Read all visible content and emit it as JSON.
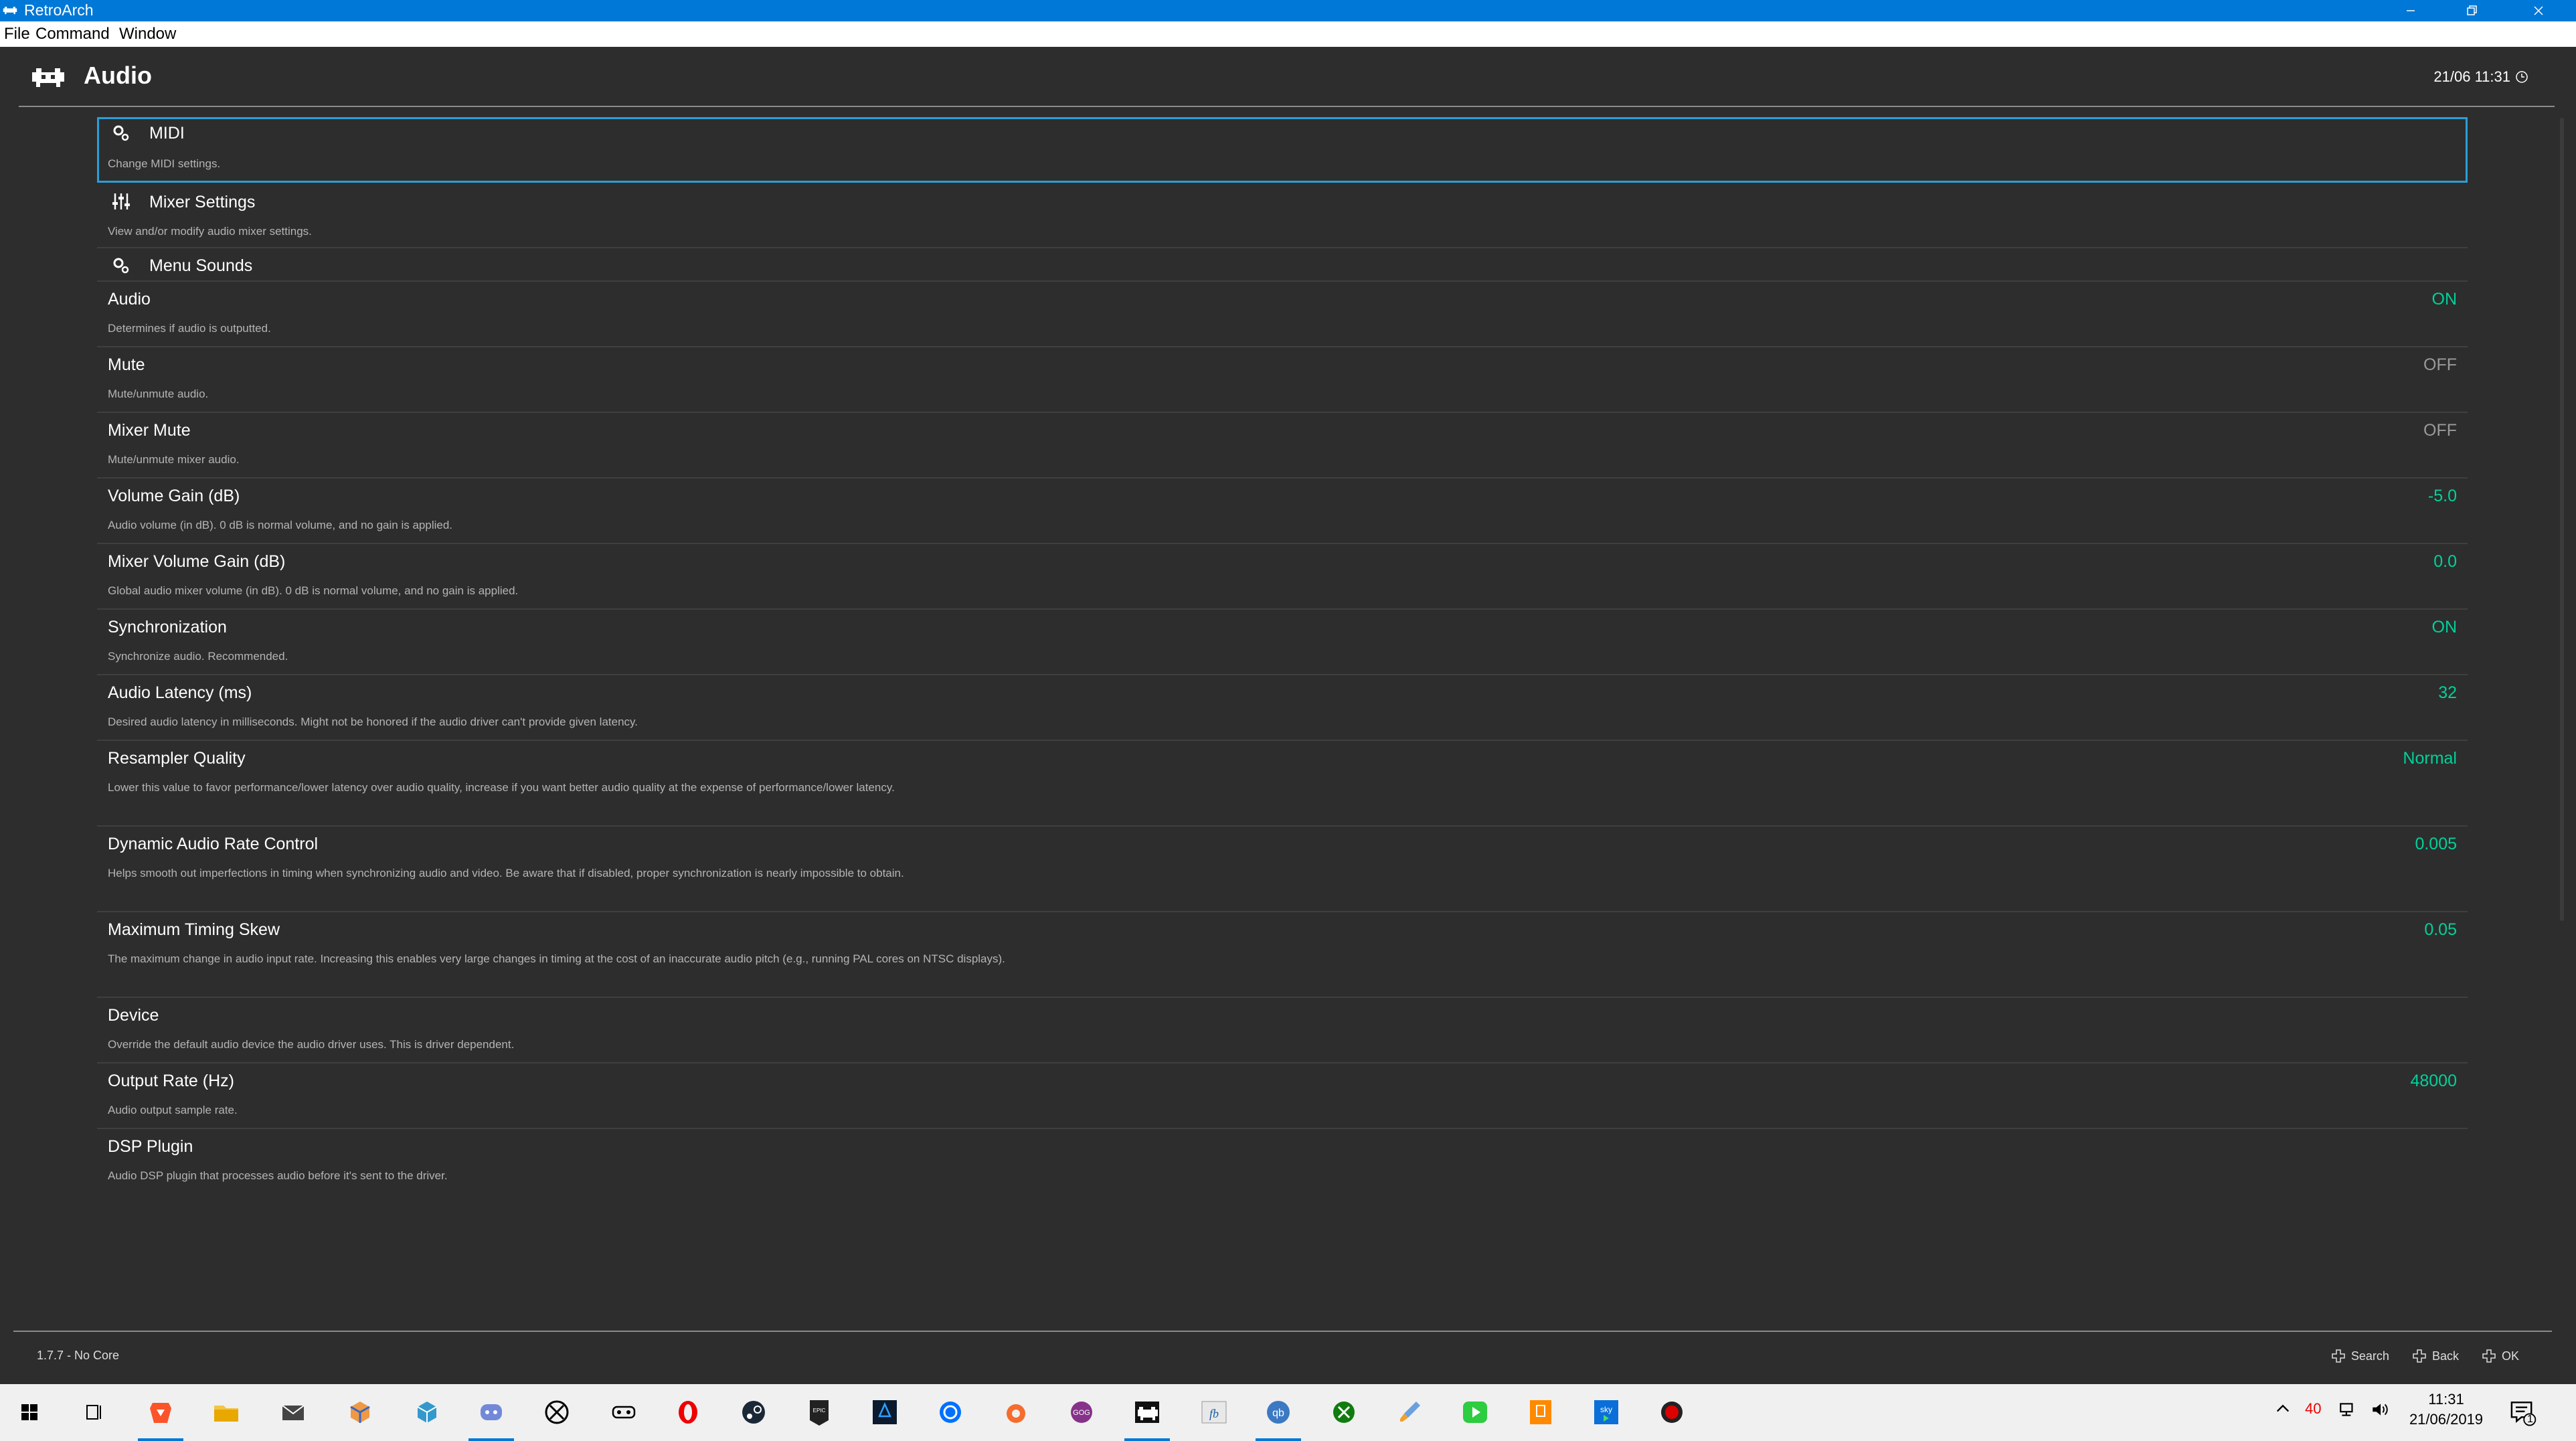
{
  "window": {
    "title": "RetroArch",
    "menu": [
      "File",
      "Command",
      "Window"
    ]
  },
  "header": {
    "title": "Audio",
    "clock": "21/06 11:31"
  },
  "items": [
    {
      "label": "MIDI",
      "sub": "Change MIDI settings.",
      "icon": "gear-icon",
      "value": ""
    },
    {
      "label": "Mixer Settings",
      "sub": "View and/or modify audio mixer settings.",
      "icon": "mixer-sliders-icon",
      "value": ""
    },
    {
      "label": "Menu Sounds",
      "sub": "",
      "icon": "gear-icon",
      "value": ""
    },
    {
      "label": "Audio",
      "sub": "Determines if audio is outputted.",
      "value": "ON"
    },
    {
      "label": "Mute",
      "sub": "Mute/unmute audio.",
      "value": "OFF"
    },
    {
      "label": "Mixer Mute",
      "sub": "Mute/unmute mixer audio.",
      "value": "OFF"
    },
    {
      "label": "Volume Gain (dB)",
      "sub": "Audio volume (in dB). 0 dB is normal volume, and no gain is applied.",
      "value": "-5.0"
    },
    {
      "label": "Mixer Volume Gain (dB)",
      "sub": "Global audio mixer volume (in dB). 0 dB is normal volume, and no gain is applied.",
      "value": "0.0"
    },
    {
      "label": "Synchronization",
      "sub": "Synchronize audio. Recommended.",
      "value": "ON"
    },
    {
      "label": "Audio Latency (ms)",
      "sub": "Desired audio latency in milliseconds. Might not be honored if the audio driver can't provide given latency.",
      "value": "32"
    },
    {
      "label": "Resampler Quality",
      "sub": "Lower this value to favor performance/lower latency over audio quality, increase if you want better audio quality at the expense of performance/lower latency.",
      "value": "Normal"
    },
    {
      "label": "Dynamic Audio Rate Control",
      "sub": "Helps smooth out imperfections in timing when synchronizing audio and video. Be aware that if disabled, proper synchronization is nearly impossible to obtain.",
      "value": "0.005"
    },
    {
      "label": "Maximum Timing Skew",
      "sub": "The maximum change in audio input rate. Increasing this enables very large changes in timing at the cost of an inaccurate audio pitch (e.g., running PAL cores on NTSC displays).",
      "value": "0.05"
    },
    {
      "label": "Device",
      "sub": "Override the default audio device the audio driver uses. This is driver dependent.",
      "value": ""
    },
    {
      "label": "Output Rate (Hz)",
      "sub": "Audio output sample rate.",
      "value": "48000"
    },
    {
      "label": "DSP Plugin",
      "sub": "Audio DSP plugin that processes audio before it's sent to the driver.",
      "value": ""
    }
  ],
  "footer": {
    "version": "1.7.7 - No Core",
    "search": "Search",
    "back": "Back",
    "ok": "OK"
  },
  "taskbar": {
    "badge": "40",
    "time": "11:31",
    "date": "21/06/2019",
    "notifications": "1"
  },
  "colors": {
    "accent": "#00d29a",
    "selection": "#2a9fd8",
    "titlebar": "#0078d7"
  }
}
